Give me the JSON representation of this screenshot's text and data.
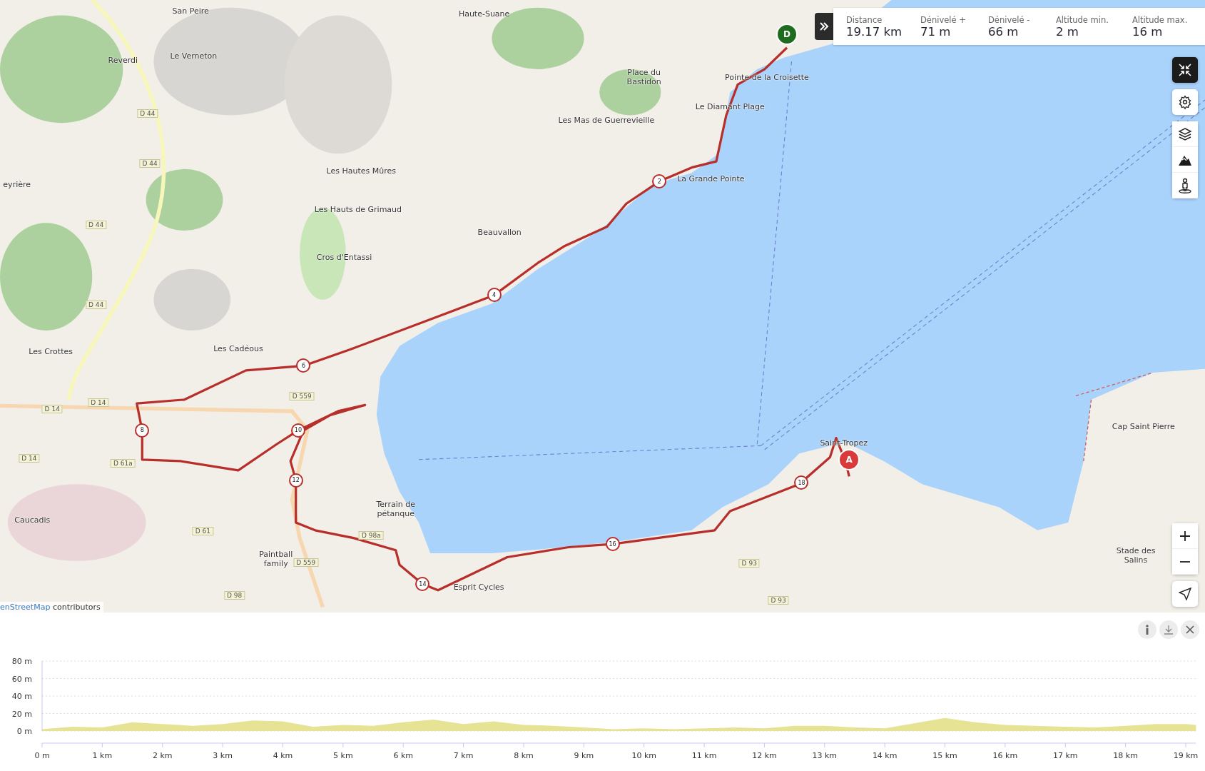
{
  "map": {
    "labels": [
      "San Peire",
      "Haute-Suane",
      "Reverdi",
      "Le Verneton",
      "Place du Bastidon",
      "Pointe de la Croisette",
      "Le Diamant Plage",
      "Les Mas de Guerrevieille",
      "Les Hautes Mûres",
      "La Grande Pointe",
      "Les Hauts de Grimaud",
      "Beauvallon",
      "Cros d'Entassi",
      "Les Cadéous",
      "Les Crottes",
      "eyrière",
      "Cap Saint Pierre",
      "Saint-Tropez",
      "Caucadis",
      "Terrain de pétanque",
      "Paintball family",
      "Esprit Cycles",
      "Stade des Salins"
    ],
    "road_labels": [
      "D 44",
      "D 44",
      "D 44",
      "D 44",
      "D 14",
      "D 14",
      "D 14",
      "D 559",
      "D 559",
      "D 61a",
      "D 61",
      "D 98a",
      "D 98",
      "D 93",
      "D 93"
    ],
    "route_markers": [
      {
        "label": "2"
      },
      {
        "label": "4"
      },
      {
        "label": "6"
      },
      {
        "label": "8"
      },
      {
        "label": "10"
      },
      {
        "label": "12"
      },
      {
        "label": "14"
      },
      {
        "label": "16"
      },
      {
        "label": "18"
      }
    ],
    "pins": [
      {
        "label": "D",
        "kind": "start"
      },
      {
        "label": "A",
        "kind": "end"
      }
    ],
    "attribution": {
      "link": "enStreetMap",
      "text": "contributors"
    }
  },
  "stats": [
    {
      "label": "Distance",
      "value": "19.17 km"
    },
    {
      "label": "Dénivelé +",
      "value": "71 m"
    },
    {
      "label": "Dénivelé -",
      "value": "66 m"
    },
    {
      "label": "Altitude min.",
      "value": "2 m"
    },
    {
      "label": "Altitude max.",
      "value": "16 m"
    }
  ],
  "profile": {
    "chart_data": {
      "type": "area",
      "grid": true,
      "x": [
        0,
        0.5,
        1,
        1.5,
        2,
        2.5,
        3,
        3.5,
        4,
        4.5,
        5,
        5.5,
        6,
        6.5,
        7,
        7.5,
        8,
        8.5,
        9,
        9.5,
        10,
        10.5,
        11,
        11.5,
        12,
        12.5,
        13,
        13.5,
        14,
        14.5,
        15,
        15.5,
        16,
        16.5,
        17,
        17.5,
        18,
        18.5,
        19,
        19.17
      ],
      "series": [
        {
          "color": "#e6e394",
          "values": [
            2,
            5,
            4,
            10,
            8,
            6,
            8,
            12,
            11,
            5,
            7,
            6,
            10,
            13,
            8,
            11,
            7,
            6,
            4,
            2,
            3,
            2,
            3,
            4,
            3,
            6,
            6,
            4,
            3,
            9,
            15,
            10,
            7,
            6,
            5,
            4,
            6,
            8,
            8,
            7
          ]
        }
      ],
      "xlim": [
        0,
        19.17
      ],
      "ylim": [
        0,
        80
      ],
      "xticks": [
        {
          "value": 0,
          "label": "0 m"
        },
        {
          "value": 1,
          "label": "1 km"
        },
        {
          "value": 2,
          "label": "2 km"
        },
        {
          "value": 3,
          "label": "3 km"
        },
        {
          "value": 4,
          "label": "4 km"
        },
        {
          "value": 5,
          "label": "5 km"
        },
        {
          "value": 6,
          "label": "6 km"
        },
        {
          "value": 7,
          "label": "7 km"
        },
        {
          "value": 8,
          "label": "8 km"
        },
        {
          "value": 9,
          "label": "9 km"
        },
        {
          "value": 10,
          "label": "10 km"
        },
        {
          "value": 11,
          "label": "11 km"
        },
        {
          "value": 12,
          "label": "12 km"
        },
        {
          "value": 13,
          "label": "13 km"
        },
        {
          "value": 14,
          "label": "14 km"
        },
        {
          "value": 15,
          "label": "15 km"
        },
        {
          "value": 16,
          "label": "16 km"
        },
        {
          "value": 17,
          "label": "17 km"
        },
        {
          "value": 18,
          "label": "18 km"
        },
        {
          "value": 19,
          "label": "19 km"
        }
      ],
      "yticks": [
        {
          "value": 0,
          "label": "0 m"
        },
        {
          "value": 20,
          "label": "20 m"
        },
        {
          "value": 40,
          "label": "40 m"
        },
        {
          "value": 60,
          "label": "60 m"
        },
        {
          "value": 80,
          "label": "80 m"
        }
      ]
    }
  }
}
